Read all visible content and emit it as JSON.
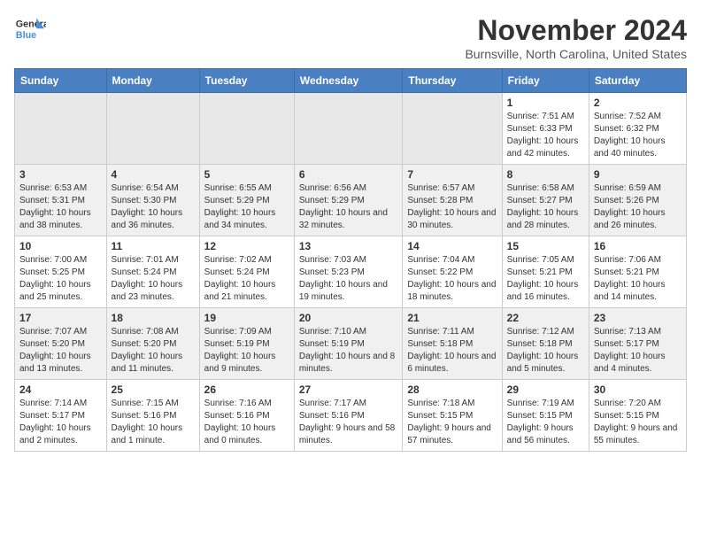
{
  "logo": {
    "line1": "General",
    "line2": "Blue"
  },
  "title": "November 2024",
  "subtitle": "Burnsville, North Carolina, United States",
  "days_of_week": [
    "Sunday",
    "Monday",
    "Tuesday",
    "Wednesday",
    "Thursday",
    "Friday",
    "Saturday"
  ],
  "weeks": [
    [
      {
        "day": "",
        "info": ""
      },
      {
        "day": "",
        "info": ""
      },
      {
        "day": "",
        "info": ""
      },
      {
        "day": "",
        "info": ""
      },
      {
        "day": "",
        "info": ""
      },
      {
        "day": "1",
        "info": "Sunrise: 7:51 AM\nSunset: 6:33 PM\nDaylight: 10 hours\nand 42 minutes."
      },
      {
        "day": "2",
        "info": "Sunrise: 7:52 AM\nSunset: 6:32 PM\nDaylight: 10 hours\nand 40 minutes."
      }
    ],
    [
      {
        "day": "3",
        "info": "Sunrise: 6:53 AM\nSunset: 5:31 PM\nDaylight: 10 hours\nand 38 minutes."
      },
      {
        "day": "4",
        "info": "Sunrise: 6:54 AM\nSunset: 5:30 PM\nDaylight: 10 hours\nand 36 minutes."
      },
      {
        "day": "5",
        "info": "Sunrise: 6:55 AM\nSunset: 5:29 PM\nDaylight: 10 hours\nand 34 minutes."
      },
      {
        "day": "6",
        "info": "Sunrise: 6:56 AM\nSunset: 5:29 PM\nDaylight: 10 hours\nand 32 minutes."
      },
      {
        "day": "7",
        "info": "Sunrise: 6:57 AM\nSunset: 5:28 PM\nDaylight: 10 hours\nand 30 minutes."
      },
      {
        "day": "8",
        "info": "Sunrise: 6:58 AM\nSunset: 5:27 PM\nDaylight: 10 hours\nand 28 minutes."
      },
      {
        "day": "9",
        "info": "Sunrise: 6:59 AM\nSunset: 5:26 PM\nDaylight: 10 hours\nand 26 minutes."
      }
    ],
    [
      {
        "day": "10",
        "info": "Sunrise: 7:00 AM\nSunset: 5:25 PM\nDaylight: 10 hours\nand 25 minutes."
      },
      {
        "day": "11",
        "info": "Sunrise: 7:01 AM\nSunset: 5:24 PM\nDaylight: 10 hours\nand 23 minutes."
      },
      {
        "day": "12",
        "info": "Sunrise: 7:02 AM\nSunset: 5:24 PM\nDaylight: 10 hours\nand 21 minutes."
      },
      {
        "day": "13",
        "info": "Sunrise: 7:03 AM\nSunset: 5:23 PM\nDaylight: 10 hours\nand 19 minutes."
      },
      {
        "day": "14",
        "info": "Sunrise: 7:04 AM\nSunset: 5:22 PM\nDaylight: 10 hours\nand 18 minutes."
      },
      {
        "day": "15",
        "info": "Sunrise: 7:05 AM\nSunset: 5:21 PM\nDaylight: 10 hours\nand 16 minutes."
      },
      {
        "day": "16",
        "info": "Sunrise: 7:06 AM\nSunset: 5:21 PM\nDaylight: 10 hours\nand 14 minutes."
      }
    ],
    [
      {
        "day": "17",
        "info": "Sunrise: 7:07 AM\nSunset: 5:20 PM\nDaylight: 10 hours\nand 13 minutes."
      },
      {
        "day": "18",
        "info": "Sunrise: 7:08 AM\nSunset: 5:20 PM\nDaylight: 10 hours\nand 11 minutes."
      },
      {
        "day": "19",
        "info": "Sunrise: 7:09 AM\nSunset: 5:19 PM\nDaylight: 10 hours\nand 9 minutes."
      },
      {
        "day": "20",
        "info": "Sunrise: 7:10 AM\nSunset: 5:19 PM\nDaylight: 10 hours\nand 8 minutes."
      },
      {
        "day": "21",
        "info": "Sunrise: 7:11 AM\nSunset: 5:18 PM\nDaylight: 10 hours\nand 6 minutes."
      },
      {
        "day": "22",
        "info": "Sunrise: 7:12 AM\nSunset: 5:18 PM\nDaylight: 10 hours\nand 5 minutes."
      },
      {
        "day": "23",
        "info": "Sunrise: 7:13 AM\nSunset: 5:17 PM\nDaylight: 10 hours\nand 4 minutes."
      }
    ],
    [
      {
        "day": "24",
        "info": "Sunrise: 7:14 AM\nSunset: 5:17 PM\nDaylight: 10 hours\nand 2 minutes."
      },
      {
        "day": "25",
        "info": "Sunrise: 7:15 AM\nSunset: 5:16 PM\nDaylight: 10 hours\nand 1 minute."
      },
      {
        "day": "26",
        "info": "Sunrise: 7:16 AM\nSunset: 5:16 PM\nDaylight: 10 hours\nand 0 minutes."
      },
      {
        "day": "27",
        "info": "Sunrise: 7:17 AM\nSunset: 5:16 PM\nDaylight: 9 hours\nand 58 minutes."
      },
      {
        "day": "28",
        "info": "Sunrise: 7:18 AM\nSunset: 5:15 PM\nDaylight: 9 hours\nand 57 minutes."
      },
      {
        "day": "29",
        "info": "Sunrise: 7:19 AM\nSunset: 5:15 PM\nDaylight: 9 hours\nand 56 minutes."
      },
      {
        "day": "30",
        "info": "Sunrise: 7:20 AM\nSunset: 5:15 PM\nDaylight: 9 hours\nand 55 minutes."
      }
    ]
  ]
}
